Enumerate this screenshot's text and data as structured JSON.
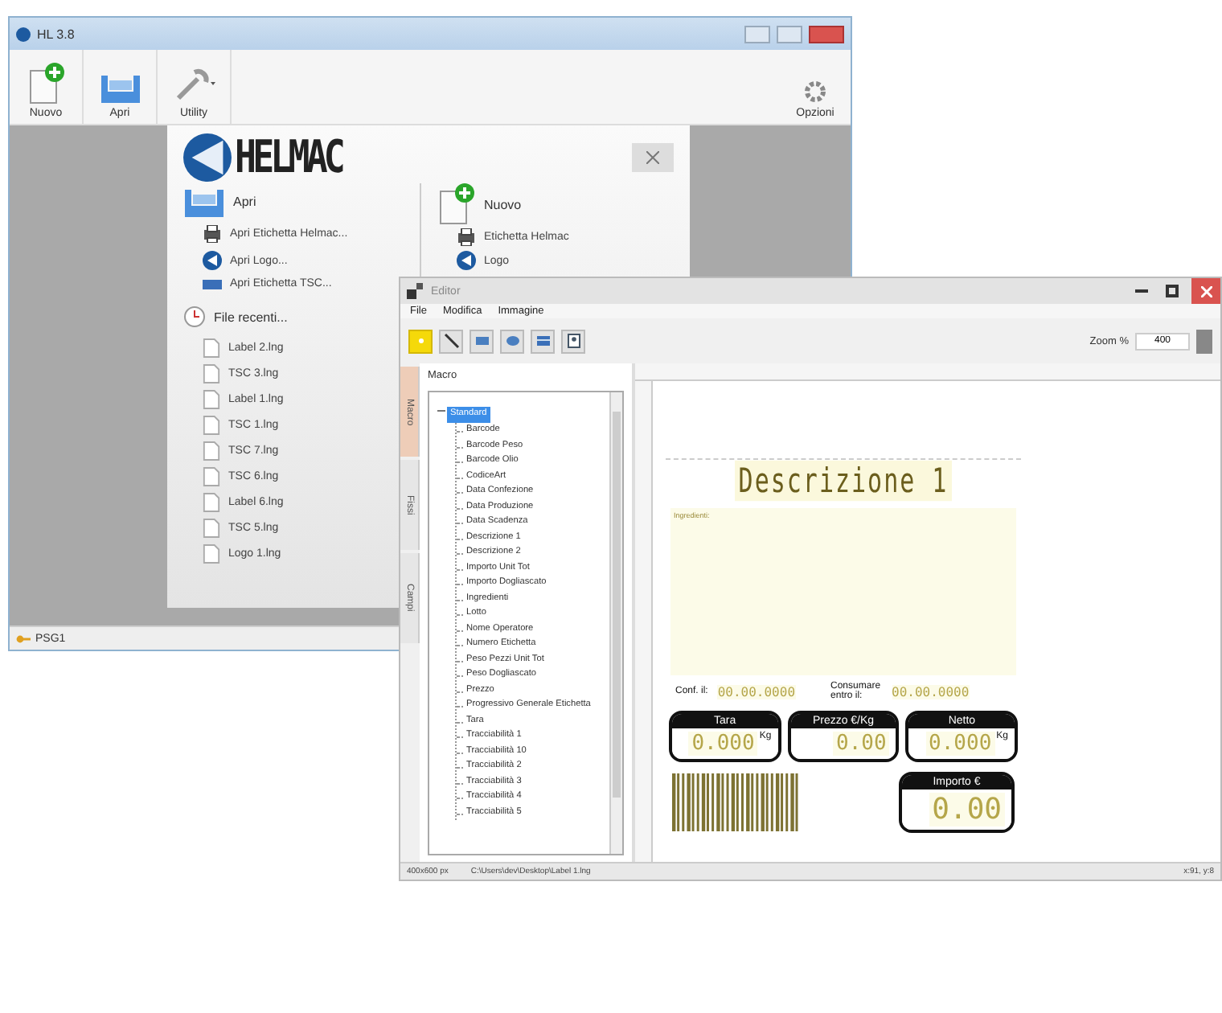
{
  "main_window": {
    "title": "HL 3.8",
    "toolbar": [
      {
        "label": "Nuovo",
        "kind": "new"
      },
      {
        "label": "Apri",
        "kind": "open"
      },
      {
        "label": "Utility",
        "kind": "utility"
      }
    ],
    "options_button": "Opzioni",
    "start_dialog": {
      "logo": "HELMAC",
      "open_section": {
        "title": "Apri",
        "items": [
          {
            "label": "Apri Etichetta Helmac...",
            "kind": "label"
          },
          {
            "label": "Apri Logo...",
            "kind": "logo"
          },
          {
            "label": "Apri Etichetta TSC...",
            "kind": "tsc"
          }
        ]
      },
      "new_section": {
        "title": "Nuovo",
        "items": [
          {
            "label": "Etichetta Helmac",
            "kind": "label"
          },
          {
            "label": "Logo",
            "kind": "logo"
          }
        ]
      },
      "recent": {
        "title": "File recenti...",
        "files": [
          "Label 2.lng",
          "TSC 3.lng",
          "Label 1.lng",
          "TSC 1.lng",
          "TSC 7.lng",
          "TSC 6.lng",
          "Label 6.lng",
          "TSC 5.lng",
          "Logo 1.lng"
        ]
      }
    },
    "status_bar": "PSG1"
  },
  "editor": {
    "title": "Editor",
    "menu": [
      "File",
      "Modifica",
      "Immagine"
    ],
    "tools": [
      {
        "kind": "pointer",
        "selected": true
      },
      {
        "kind": "line",
        "selected": false
      },
      {
        "kind": "rect",
        "selected": false
      },
      {
        "kind": "ellipse",
        "selected": false
      },
      {
        "kind": "barcode",
        "selected": false
      },
      {
        "kind": "image",
        "selected": false
      }
    ],
    "zoom_label": "Zoom %",
    "zoom_value": "400",
    "side_tabs": [
      {
        "label": "Macro",
        "selected": true
      },
      {
        "label": "Fissi",
        "selected": false
      },
      {
        "label": "Campi",
        "selected": false
      }
    ],
    "panel_title": "Macro",
    "tree": {
      "label": "Standard",
      "selected": true,
      "expanded": true,
      "children": [
        {
          "label": "Barcode",
          "selected": false
        },
        {
          "label": "Barcode Peso",
          "selected": false
        },
        {
          "label": "Barcode Olio",
          "selected": false
        },
        {
          "label": "CodiceArt",
          "selected": false
        },
        {
          "label": "Data Confezione",
          "selected": false
        },
        {
          "label": "Data Produzione",
          "selected": false
        },
        {
          "label": "Data Scadenza",
          "selected": false
        },
        {
          "label": "Descrizione 1",
          "selected": false
        },
        {
          "label": "Descrizione 2",
          "selected": false
        },
        {
          "label": "Importo Unit Tot",
          "selected": false
        },
        {
          "label": "Importo Dogliascato",
          "selected": false
        },
        {
          "label": "Ingredienti",
          "selected": false
        },
        {
          "label": "Lotto",
          "selected": false
        },
        {
          "label": "Nome Operatore",
          "selected": false
        },
        {
          "label": "Numero Etichetta",
          "selected": false
        },
        {
          "label": "Peso Pezzi Unit Tot",
          "selected": false
        },
        {
          "label": "Peso Dogliascato",
          "selected": false
        },
        {
          "label": "Prezzo",
          "selected": false
        },
        {
          "label": "Progressivo Generale Etichetta",
          "selected": false
        },
        {
          "label": "Tara",
          "selected": false
        },
        {
          "label": "Tracciabilità 1",
          "selected": false
        },
        {
          "label": "Tracciabilità 10",
          "selected": false
        },
        {
          "label": "Tracciabilità 2",
          "selected": false
        },
        {
          "label": "Tracciabilità 3",
          "selected": false
        },
        {
          "label": "Tracciabilità 4",
          "selected": false
        },
        {
          "label": "Tracciabilità 5",
          "selected": false
        }
      ]
    },
    "label_canvas": {
      "description": "Descrizione 1",
      "ingredients": "Ingredienti:",
      "dates": [
        {
          "caption": "Conf. il:",
          "value": "00.00.0000"
        },
        {
          "caption": "Consumare entro il:",
          "value": "00.00.0000"
        }
      ],
      "boxes": [
        {
          "title": "Tara",
          "value": "0.000",
          "unit": "Kg"
        },
        {
          "title": "Prezzo €/Kg",
          "value": "0.00"
        },
        {
          "title": "Netto",
          "value": "0.000",
          "unit": "Kg"
        }
      ],
      "total": {
        "title": "Importo €",
        "value": "0.00"
      }
    },
    "status_bar": [
      "400x600 px",
      "C:\\Users\\dev\\Desktop\\Label 1.lng",
      "x:91, y:8"
    ]
  }
}
